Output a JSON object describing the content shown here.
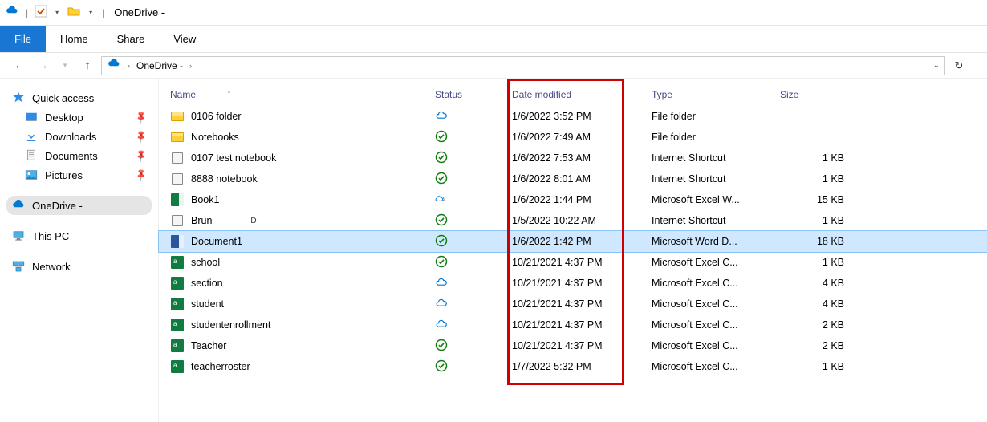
{
  "titlebar": {
    "title": "OneDrive -"
  },
  "ribbon": {
    "tabs": {
      "file": "File",
      "home": "Home",
      "share": "Share",
      "view": "View"
    }
  },
  "breadcrumb": {
    "root_icon": "cloud-icon",
    "item": "OneDrive -"
  },
  "sidebar": {
    "quick_access": "Quick access",
    "desktop": "Desktop",
    "downloads": "Downloads",
    "documents": "Documents",
    "pictures": "Pictures",
    "onedrive": "OneDrive -",
    "thispc": "This PC",
    "network": "Network"
  },
  "columns": {
    "name": "Name",
    "status": "Status",
    "date": "Date modified",
    "type": "Type",
    "size": "Size"
  },
  "files": [
    {
      "icon": "folder",
      "name": "0106 folder",
      "status": "cloud-blue",
      "date": "1/6/2022 3:52 PM",
      "type": "File folder",
      "size": ""
    },
    {
      "icon": "folder",
      "name": "Notebooks",
      "status": "sync-green",
      "date": "1/6/2022 7:49 AM",
      "type": "File folder",
      "size": ""
    },
    {
      "icon": "url",
      "name": "0107 test notebook",
      "status": "sync-green",
      "date": "1/6/2022 7:53 AM",
      "type": "Internet Shortcut",
      "size": "1 KB"
    },
    {
      "icon": "url",
      "name": "8888 notebook",
      "status": "sync-green",
      "date": "1/6/2022 8:01 AM",
      "type": "Internet Shortcut",
      "size": "1 KB"
    },
    {
      "icon": "excel",
      "name": "Book1",
      "status": "cloud-shared",
      "date": "1/6/2022 1:44 PM",
      "type": "Microsoft Excel W...",
      "size": "15 KB"
    },
    {
      "icon": "url",
      "name": "Brun",
      "suffix": "D",
      "status": "sync-green",
      "date": "1/5/2022 10:22 AM",
      "type": "Internet Shortcut",
      "size": "1 KB"
    },
    {
      "icon": "word",
      "name": "Document1",
      "status": "sync-green",
      "date": "1/6/2022 1:42 PM",
      "type": "Microsoft Word D...",
      "size": "18 KB",
      "selected": true
    },
    {
      "icon": "excel-csv",
      "name": "school",
      "status": "sync-green",
      "date": "10/21/2021 4:37 PM",
      "type": "Microsoft Excel C...",
      "size": "1 KB"
    },
    {
      "icon": "excel-csv",
      "name": "section",
      "status": "cloud-blue",
      "date": "10/21/2021 4:37 PM",
      "type": "Microsoft Excel C...",
      "size": "4 KB"
    },
    {
      "icon": "excel-csv",
      "name": "student",
      "status": "cloud-blue",
      "date": "10/21/2021 4:37 PM",
      "type": "Microsoft Excel C...",
      "size": "4 KB"
    },
    {
      "icon": "excel-csv",
      "name": "studentenrollment",
      "status": "cloud-blue",
      "date": "10/21/2021 4:37 PM",
      "type": "Microsoft Excel C...",
      "size": "2 KB"
    },
    {
      "icon": "excel-csv",
      "name": "Teacher",
      "status": "sync-green",
      "date": "10/21/2021 4:37 PM",
      "type": "Microsoft Excel C...",
      "size": "2 KB"
    },
    {
      "icon": "excel-csv",
      "name": "teacherroster",
      "status": "sync-green",
      "date": "1/7/2022 5:32 PM",
      "type": "Microsoft Excel C...",
      "size": "1 KB"
    }
  ]
}
